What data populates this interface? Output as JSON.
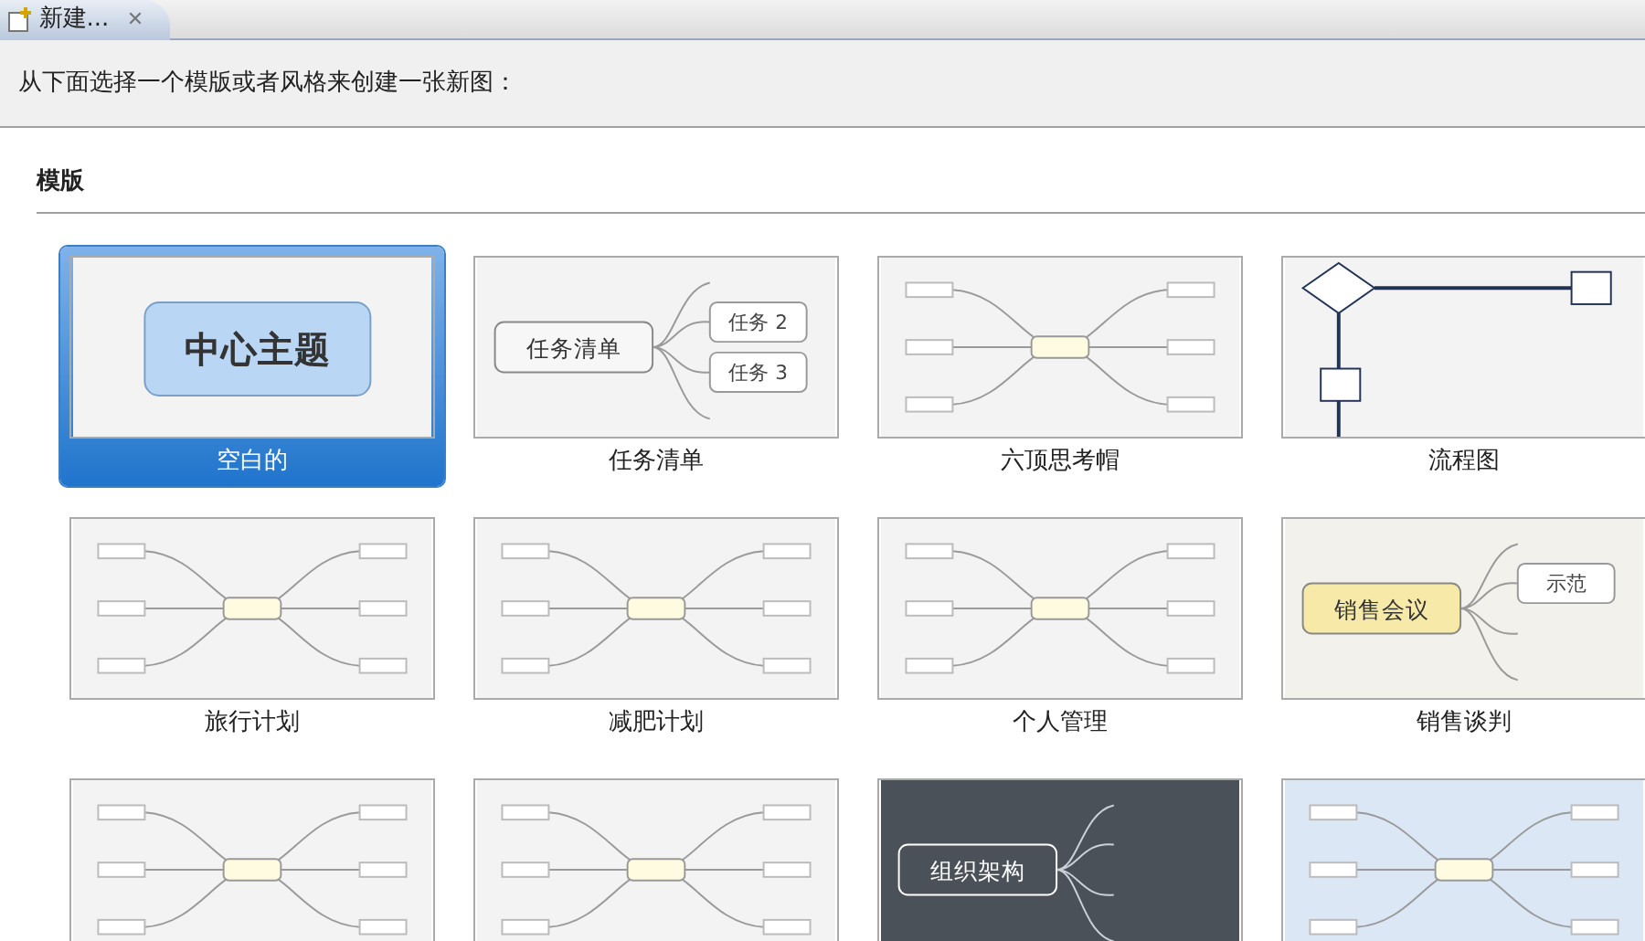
{
  "tab": {
    "title": "新建...",
    "close": "✕"
  },
  "instruction": "从下面选择一个模版或者风格来创建一张新图：",
  "section": {
    "title": "模版"
  },
  "templates": [
    {
      "label": "空白的",
      "selected": true,
      "kind": "blank",
      "texts": [
        "中心主题"
      ]
    },
    {
      "label": "任务清单",
      "selected": false,
      "kind": "tasks",
      "texts": [
        "任务清单",
        "任务 2",
        "任务 3"
      ]
    },
    {
      "label": "六顶思考帽",
      "selected": false,
      "kind": "map"
    },
    {
      "label": "流程图",
      "selected": false,
      "kind": "flow"
    },
    {
      "label": "旅行计划",
      "selected": false,
      "kind": "map"
    },
    {
      "label": "减肥计划",
      "selected": false,
      "kind": "map"
    },
    {
      "label": "个人管理",
      "selected": false,
      "kind": "map"
    },
    {
      "label": "销售谈判",
      "selected": false,
      "kind": "sales",
      "texts": [
        "销售会议",
        "示范"
      ]
    },
    {
      "selected": false,
      "kind": "map"
    },
    {
      "selected": false,
      "kind": "map"
    },
    {
      "selected": false,
      "kind": "org",
      "texts": [
        "组织架构"
      ]
    },
    {
      "selected": false,
      "kind": "plan"
    }
  ]
}
